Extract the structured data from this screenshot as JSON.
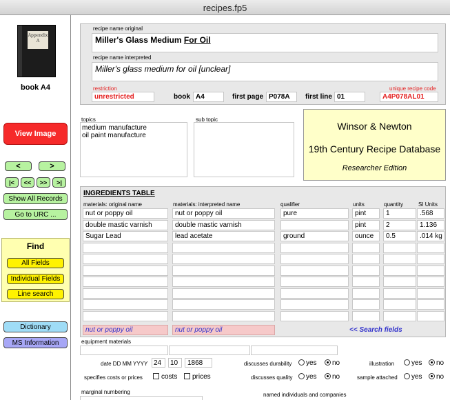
{
  "window": {
    "title": "recipes.fp5"
  },
  "sidebar": {
    "book_caption": "book  A4",
    "book_label": "Appendix A",
    "view_image": "View Image",
    "prev": "<",
    "next": ">",
    "first": "|<",
    "back": "<<",
    "forward": ">>",
    "last": ">|",
    "show_all": "Show All Records",
    "go_urc": "Go to URC ...",
    "find": {
      "title": "Find",
      "all_fields": "All Fields",
      "individual_fields": "Individual Fields",
      "line_search": "Line search"
    },
    "dictionary": "Dictionary",
    "ms_information": "MS Information"
  },
  "record": {
    "name_original_label": "recipe name original",
    "name_original": "Miller's Glass Medium ",
    "name_original_underlined": "For Oil",
    "name_interpreted_label": "recipe name interpreted",
    "name_interpreted": "Miller's glass medium for oil [unclear]",
    "restriction_label": "restriction",
    "restriction": "unrestricted",
    "book_label": "book",
    "book": "A4",
    "first_page_label": "first page",
    "first_page": "P078A",
    "first_line_label": "first line",
    "first_line": "01",
    "unique_code_label": "unique recipe code",
    "unique_code": "A4P078AL01"
  },
  "topics": {
    "topics_label": "topics",
    "topics": [
      "medium manufacture",
      "oil paint manufacture"
    ],
    "sub_topic_label": "sub topic"
  },
  "info": {
    "line1": "Winsor & Newton",
    "line2": "19th Century Recipe Database",
    "line3": "Researcher Edition"
  },
  "ingredients": {
    "title": "INGREDIENTS TABLE",
    "headers": [
      "materials: original name",
      "materials: interpreted name",
      "qualifier",
      "units",
      "quantity",
      "SI Units"
    ],
    "rows": [
      [
        "nut or poppy oil",
        "nut or poppy oil",
        "pure",
        "pint",
        "1",
        ".568"
      ],
      [
        "double mastic varnish",
        "double mastic varnish",
        "",
        "pint",
        "2",
        "1.136"
      ],
      [
        "Sugar Lead",
        "lead acetate",
        "ground",
        "ounce",
        "0.5",
        ".014 kg"
      ]
    ],
    "search_original": "nut or poppy oil",
    "search_interpreted": "nut or poppy oil",
    "search_fields_link": "<< Search fields"
  },
  "details": {
    "equipment_label": "equipment materials",
    "date_label": "date  DD MM YYYY",
    "date_dd": "24",
    "date_mm": "10",
    "date_yyyy": "1868",
    "durability_label": "discusses durability",
    "quality_label": "discusses quality",
    "illustration_label": "illustration",
    "sample_label": "sample attached",
    "yes": "yes",
    "no": "no",
    "costs_label": "specifies costs or prices",
    "costs": "costs",
    "prices": "prices",
    "marginal_label": "marginal numbering",
    "named_label": "named individuals and companies"
  }
}
